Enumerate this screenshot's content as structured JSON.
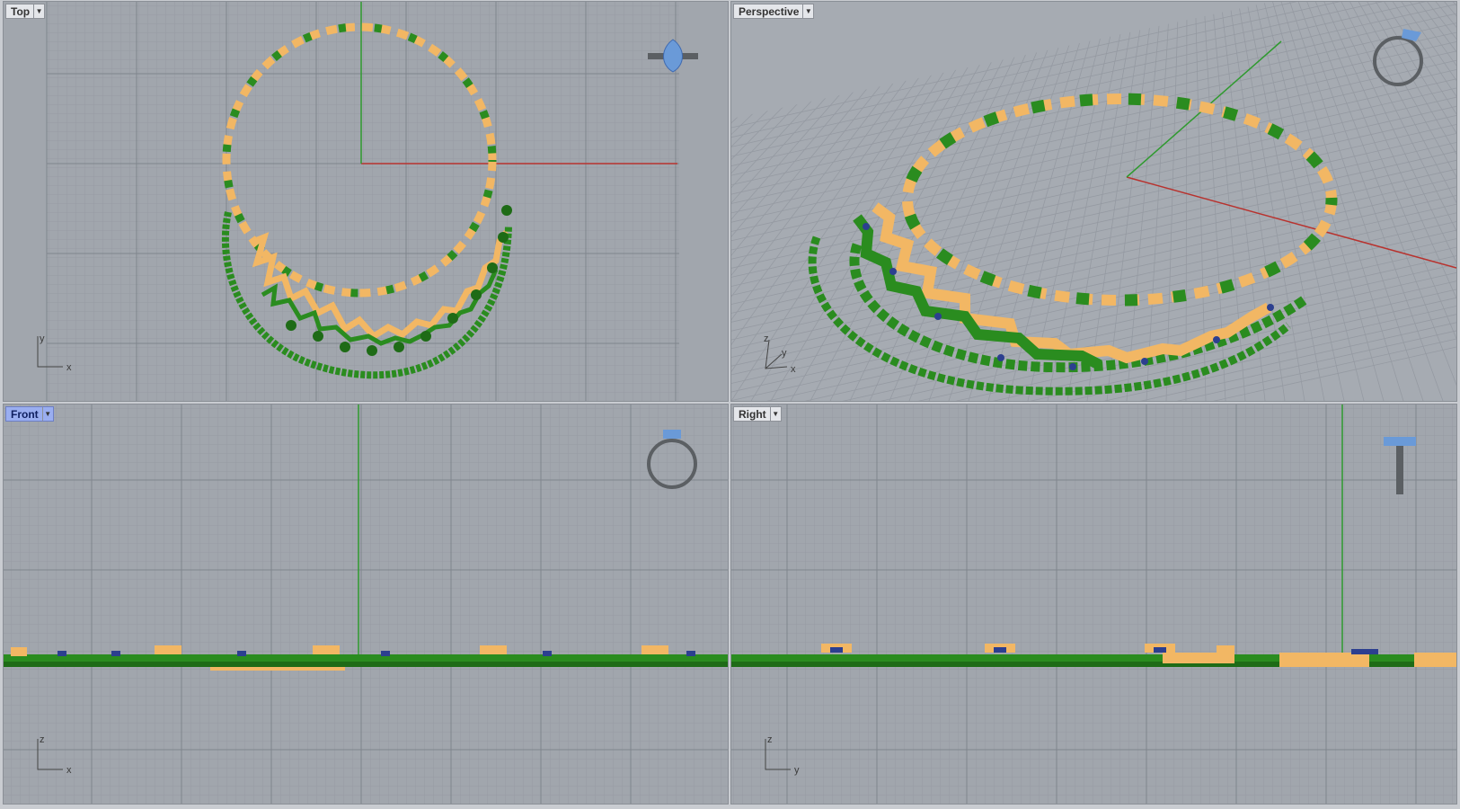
{
  "viewports": {
    "top": {
      "label": "Top",
      "axis_a": "y",
      "axis_b": "x",
      "active": false
    },
    "persp": {
      "label": "Perspective",
      "axis_a": "z",
      "axis_b": "y",
      "axis_c": "x",
      "active": false
    },
    "front": {
      "label": "Front",
      "axis_a": "z",
      "axis_b": "x",
      "active": true
    },
    "right": {
      "label": "Right",
      "axis_a": "z",
      "axis_b": "y",
      "active": false
    }
  },
  "colors": {
    "viewport_bg": "#a1a6ad",
    "grid_minor": "#969ba3",
    "grid_major": "#7f858d",
    "axis_x": "#b8322e",
    "axis_y": "#2f9a2f",
    "gold": "#f2b764",
    "green": "#2a8c1f",
    "dark_green": "#1e6b16",
    "blue_stone": "#2c3f8f",
    "ring_metal": "#5b5f63",
    "ring_stone": "#6a9ad8"
  },
  "icons": {
    "dropdown": "chevron-down-icon",
    "ring_widget": "ring-preview-icon"
  }
}
